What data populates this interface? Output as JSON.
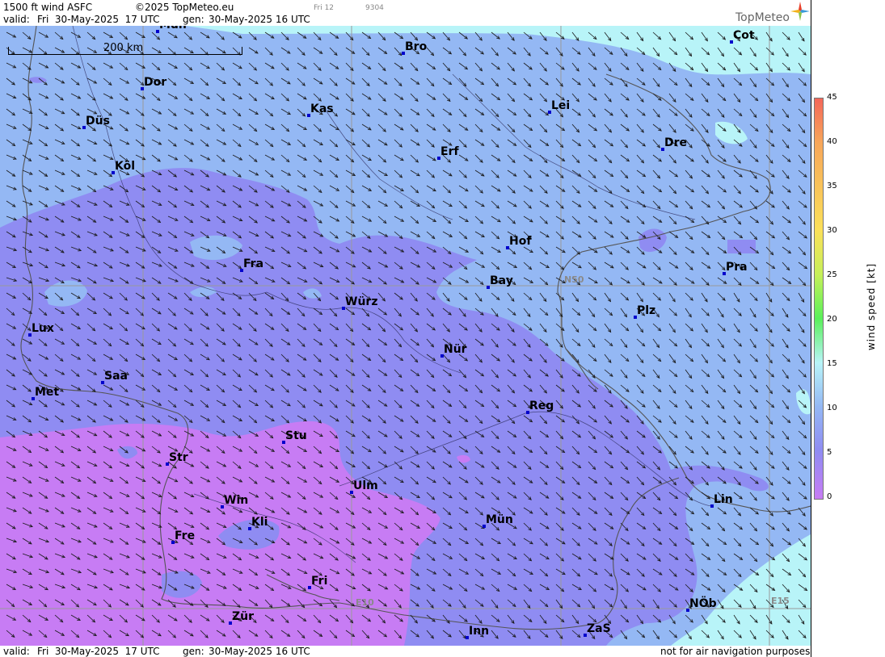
{
  "header": {
    "product": "1500 ft wind ASFC",
    "copyright": "©2025 TopMeteo.eu",
    "small_time": "Fri 12",
    "small_code": "9304",
    "valid_label": "valid:",
    "valid_value": "Fri  30-May-2025  17 UTC",
    "gen_label": "gen:",
    "gen_value": "30-May-2025 16 UTC",
    "logo_text": "TopMeteo"
  },
  "scale": {
    "label": "200 km"
  },
  "grid_labels": {
    "lat": "N50",
    "lon1": "E10",
    "lon2": "E15"
  },
  "cities": [
    {
      "name": "Mün",
      "key": "mun-north"
    },
    {
      "name": "Bro",
      "key": "bro"
    },
    {
      "name": "Cot",
      "key": "cot"
    },
    {
      "name": "Dor",
      "key": "dor"
    },
    {
      "name": "Kas",
      "key": "kas"
    },
    {
      "name": "Lei",
      "key": "lei"
    },
    {
      "name": "Düs",
      "key": "dus"
    },
    {
      "name": "Erf",
      "key": "erf"
    },
    {
      "name": "Dre",
      "key": "dre"
    },
    {
      "name": "Köl",
      "key": "kol"
    },
    {
      "name": "Hof",
      "key": "hof"
    },
    {
      "name": "Fra",
      "key": "fra"
    },
    {
      "name": "Pra",
      "key": "pra"
    },
    {
      "name": "Bay",
      "key": "bay"
    },
    {
      "name": "Würz",
      "key": "wur"
    },
    {
      "name": "Plz",
      "key": "plz"
    },
    {
      "name": "Lux",
      "key": "lux"
    },
    {
      "name": "Nür",
      "key": "nur"
    },
    {
      "name": "Saa",
      "key": "saa"
    },
    {
      "name": "Met",
      "key": "met"
    },
    {
      "name": "Reg",
      "key": "reg"
    },
    {
      "name": "Stu",
      "key": "stu"
    },
    {
      "name": "Str",
      "key": "str"
    },
    {
      "name": "Ulm",
      "key": "ulm"
    },
    {
      "name": "Win",
      "key": "win"
    },
    {
      "name": "Lin",
      "key": "lin"
    },
    {
      "name": "Kli",
      "key": "kli"
    },
    {
      "name": "Mün",
      "key": "mun"
    },
    {
      "name": "Fre",
      "key": "fre"
    },
    {
      "name": "Fri",
      "key": "fri"
    },
    {
      "name": "NÖb",
      "key": "nob"
    },
    {
      "name": "Zür",
      "key": "zur"
    },
    {
      "name": "ZaS",
      "key": "zas"
    },
    {
      "name": "Inn",
      "key": "inn"
    }
  ],
  "legend": {
    "title": "wind speed [kt]",
    "ticks": [
      "45",
      "40",
      "35",
      "30",
      "25",
      "20",
      "15",
      "10",
      "5",
      "0"
    ]
  },
  "footer": {
    "valid_label": "valid:",
    "valid_value": "Fri  30-May-2025  17 UTC",
    "gen_label": "gen:",
    "gen_value": "30-May-2025 16 UTC",
    "disclaimer": "not for air navigation purposes"
  },
  "colors": {
    "speed_0_5": "#c77cf4",
    "speed_5_10": "#8f8cf2",
    "speed_10_15": "#94b8f4",
    "speed_15_20": "#b8f4f8",
    "grid": "#9a9a9a",
    "border": "#555555"
  }
}
